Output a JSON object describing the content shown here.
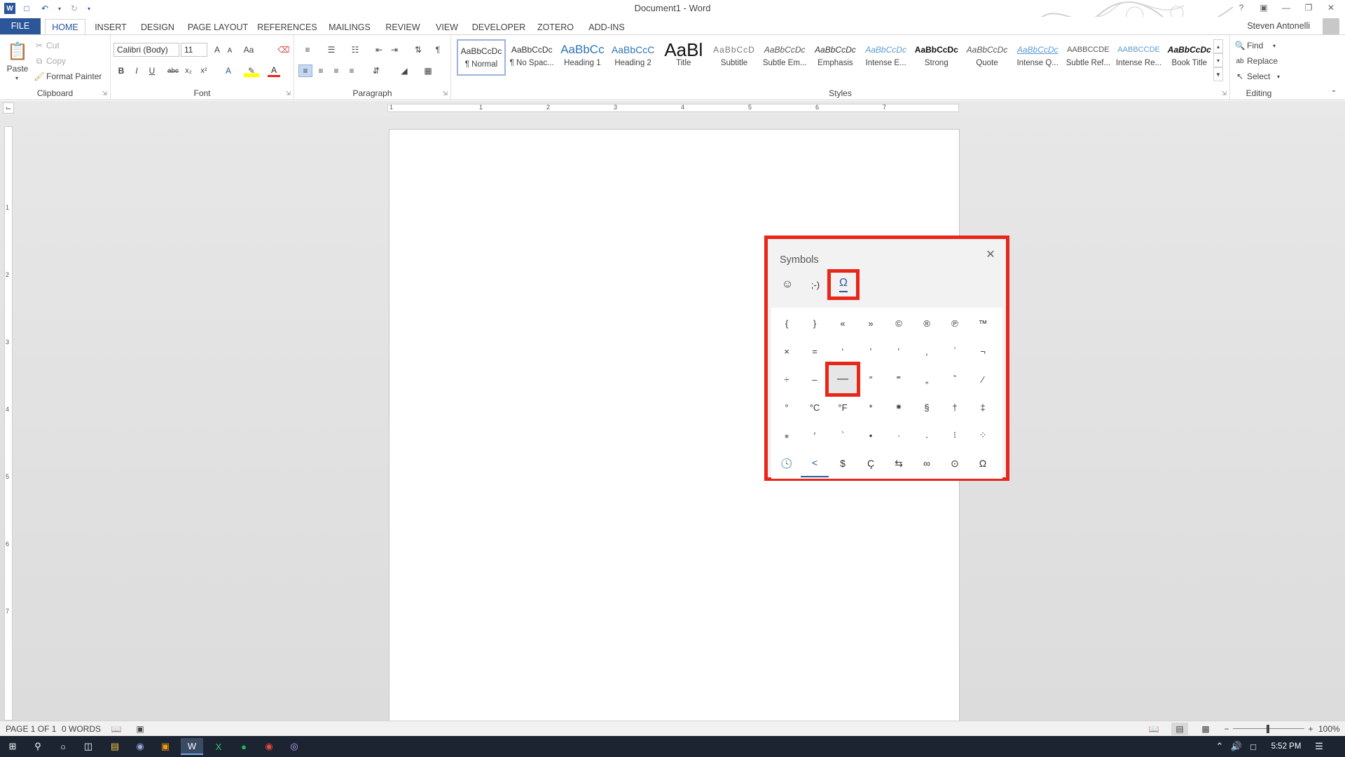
{
  "window": {
    "title": "Document1 - Word"
  },
  "user": {
    "name": "Steven Antonelli"
  },
  "tabs": [
    "FILE",
    "HOME",
    "INSERT",
    "DESIGN",
    "PAGE LAYOUT",
    "REFERENCES",
    "MAILINGS",
    "REVIEW",
    "VIEW",
    "DEVELOPER",
    "ZOTERO",
    "ADD-INS"
  ],
  "ribbon": {
    "clipboard": {
      "label": "Clipboard",
      "paste": "Paste",
      "cut": "Cut",
      "copy": "Copy",
      "format_painter": "Format Painter"
    },
    "font": {
      "label": "Font",
      "font_name": "Calibri (Body)",
      "font_size": "11",
      "bold": "B",
      "italic": "I",
      "underline": "U",
      "strike": "abc",
      "subscript": "x₂",
      "superscript": "x²",
      "grow": "A",
      "shrink": "A",
      "change_case": "Aa"
    },
    "paragraph": {
      "label": "Paragraph"
    },
    "styles": {
      "label": "Styles",
      "items": [
        {
          "preview": "AaBbCcDc",
          "name": "¶ Normal"
        },
        {
          "preview": "AaBbCcDc",
          "name": "¶ No Spac..."
        },
        {
          "preview": "AaBbCc",
          "name": "Heading 1"
        },
        {
          "preview": "AaBbCcC",
          "name": "Heading 2"
        },
        {
          "preview": "AaBl",
          "name": "Title"
        },
        {
          "preview": "AaBbCcD",
          "name": "Subtitle"
        },
        {
          "preview": "AaBbCcDc",
          "name": "Subtle Em..."
        },
        {
          "preview": "AaBbCcDc",
          "name": "Emphasis"
        },
        {
          "preview": "AaBbCcDc",
          "name": "Intense E..."
        },
        {
          "preview": "AaBbCcDc",
          "name": "Strong"
        },
        {
          "preview": "AaBbCcDc",
          "name": "Quote"
        },
        {
          "preview": "AaBbCcDc",
          "name": "Intense Q..."
        },
        {
          "preview": "AABBCCDE",
          "name": "Subtle Ref..."
        },
        {
          "preview": "AABBCCDE",
          "name": "Intense Re..."
        },
        {
          "preview": "AaBbCcDc",
          "name": "Book Title"
        }
      ]
    },
    "editing": {
      "label": "Editing",
      "find": "Find",
      "replace": "Replace",
      "select": "Select"
    }
  },
  "ruler": {
    "h_numbers": [
      "1",
      "1",
      "2",
      "3",
      "4",
      "5",
      "6",
      "7"
    ],
    "v_numbers": [
      "1",
      "2",
      "3",
      "4",
      "5",
      "6",
      "7"
    ]
  },
  "symbols_panel": {
    "title": "Symbols",
    "tabs": [
      {
        "glyph": "☺",
        "icon": "emoji-icon"
      },
      {
        "glyph": ";-)",
        "icon": "kaomoji-icon"
      },
      {
        "glyph": "Ω",
        "icon": "omega-icon",
        "selected": true
      }
    ],
    "grid": [
      [
        "{",
        "}",
        "«",
        "»",
        "©",
        "®",
        "℗",
        "™"
      ],
      [
        "×",
        "=",
        "‘",
        "’",
        "‛",
        "‚",
        "‵",
        "¬"
      ],
      [
        "÷",
        "–",
        "—",
        "″",
        "‴",
        "„",
        "‶",
        "⁄"
      ],
      [
        "°",
        "°C",
        "°F",
        "*",
        "⁕",
        "§",
        "†",
        "‡"
      ],
      [
        "⁎",
        "′",
        "‵",
        "•",
        "·",
        "․",
        "⁝",
        "⁘"
      ]
    ],
    "highlighted_cell": "—",
    "categories": [
      "🕓",
      "<",
      "$",
      "Ç",
      "⇆",
      "∞",
      "⊙",
      "Ω"
    ],
    "active_category": "<"
  },
  "status": {
    "page": "PAGE 1 OF 1",
    "words": "0 WORDS",
    "zoom": "100%"
  },
  "taskbar": {
    "time": "5:52 PM"
  },
  "colors": {
    "accent": "#2b579a",
    "highlight_red": "#e8261a",
    "taskbar": "#1c2432"
  }
}
